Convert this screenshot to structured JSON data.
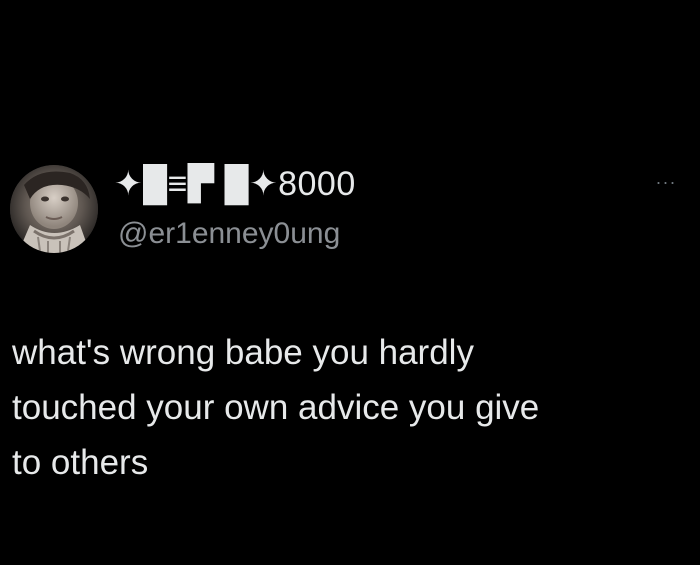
{
  "tweet": {
    "author": {
      "display_name": "✦█≡▛ █✦8000",
      "handle": "@er1enney0ung"
    },
    "more_label": "···",
    "text": "what's wrong babe you hardly\ntouched your own advice you give\nto others"
  },
  "icons": {
    "more": "more-horizontal-icon",
    "avatar": "profile-photo"
  },
  "colors": {
    "background": "#000000",
    "primary_text": "#e7e9ea",
    "secondary_text": "#8b8f94",
    "icon_muted": "#6e767d"
  }
}
